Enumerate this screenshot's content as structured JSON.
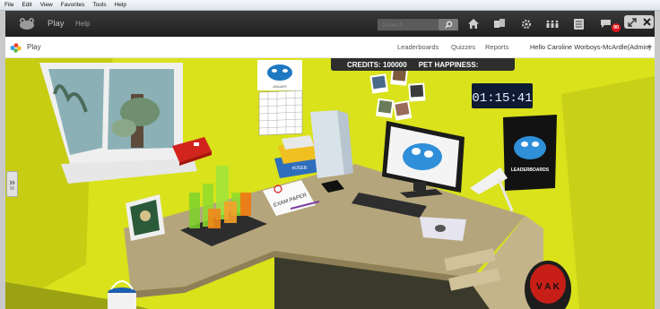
{
  "ie_menu": [
    "File",
    "Edit",
    "View",
    "Favorites",
    "Tools",
    "Help"
  ],
  "topbar": {
    "play_label": "Play",
    "help_label": "Help",
    "search_placeholder": "Search",
    "notification_count": "90"
  },
  "navbar": {
    "play_label": "Play",
    "links": [
      "Leaderboards",
      "Quizzes",
      "Reports"
    ],
    "user_greeting": "Hello Caroline Worboys-McArdle(Admin)"
  },
  "scene": {
    "credits_label": "CREDITS: 100000",
    "pet_happiness_label": "PET HAPPINESS:",
    "clock_text": "01:15:41",
    "poster_text": "LEADERBOARDS",
    "exam_paper_text": "EXAM PAPER",
    "calendar_text": "JANUARY",
    "book_text": "eUSER",
    "bin_text": "V A K"
  },
  "colors": {
    "wall": "#d9e21b",
    "desk": "#b5a57c",
    "brand_dark": "#2e2e2e"
  }
}
